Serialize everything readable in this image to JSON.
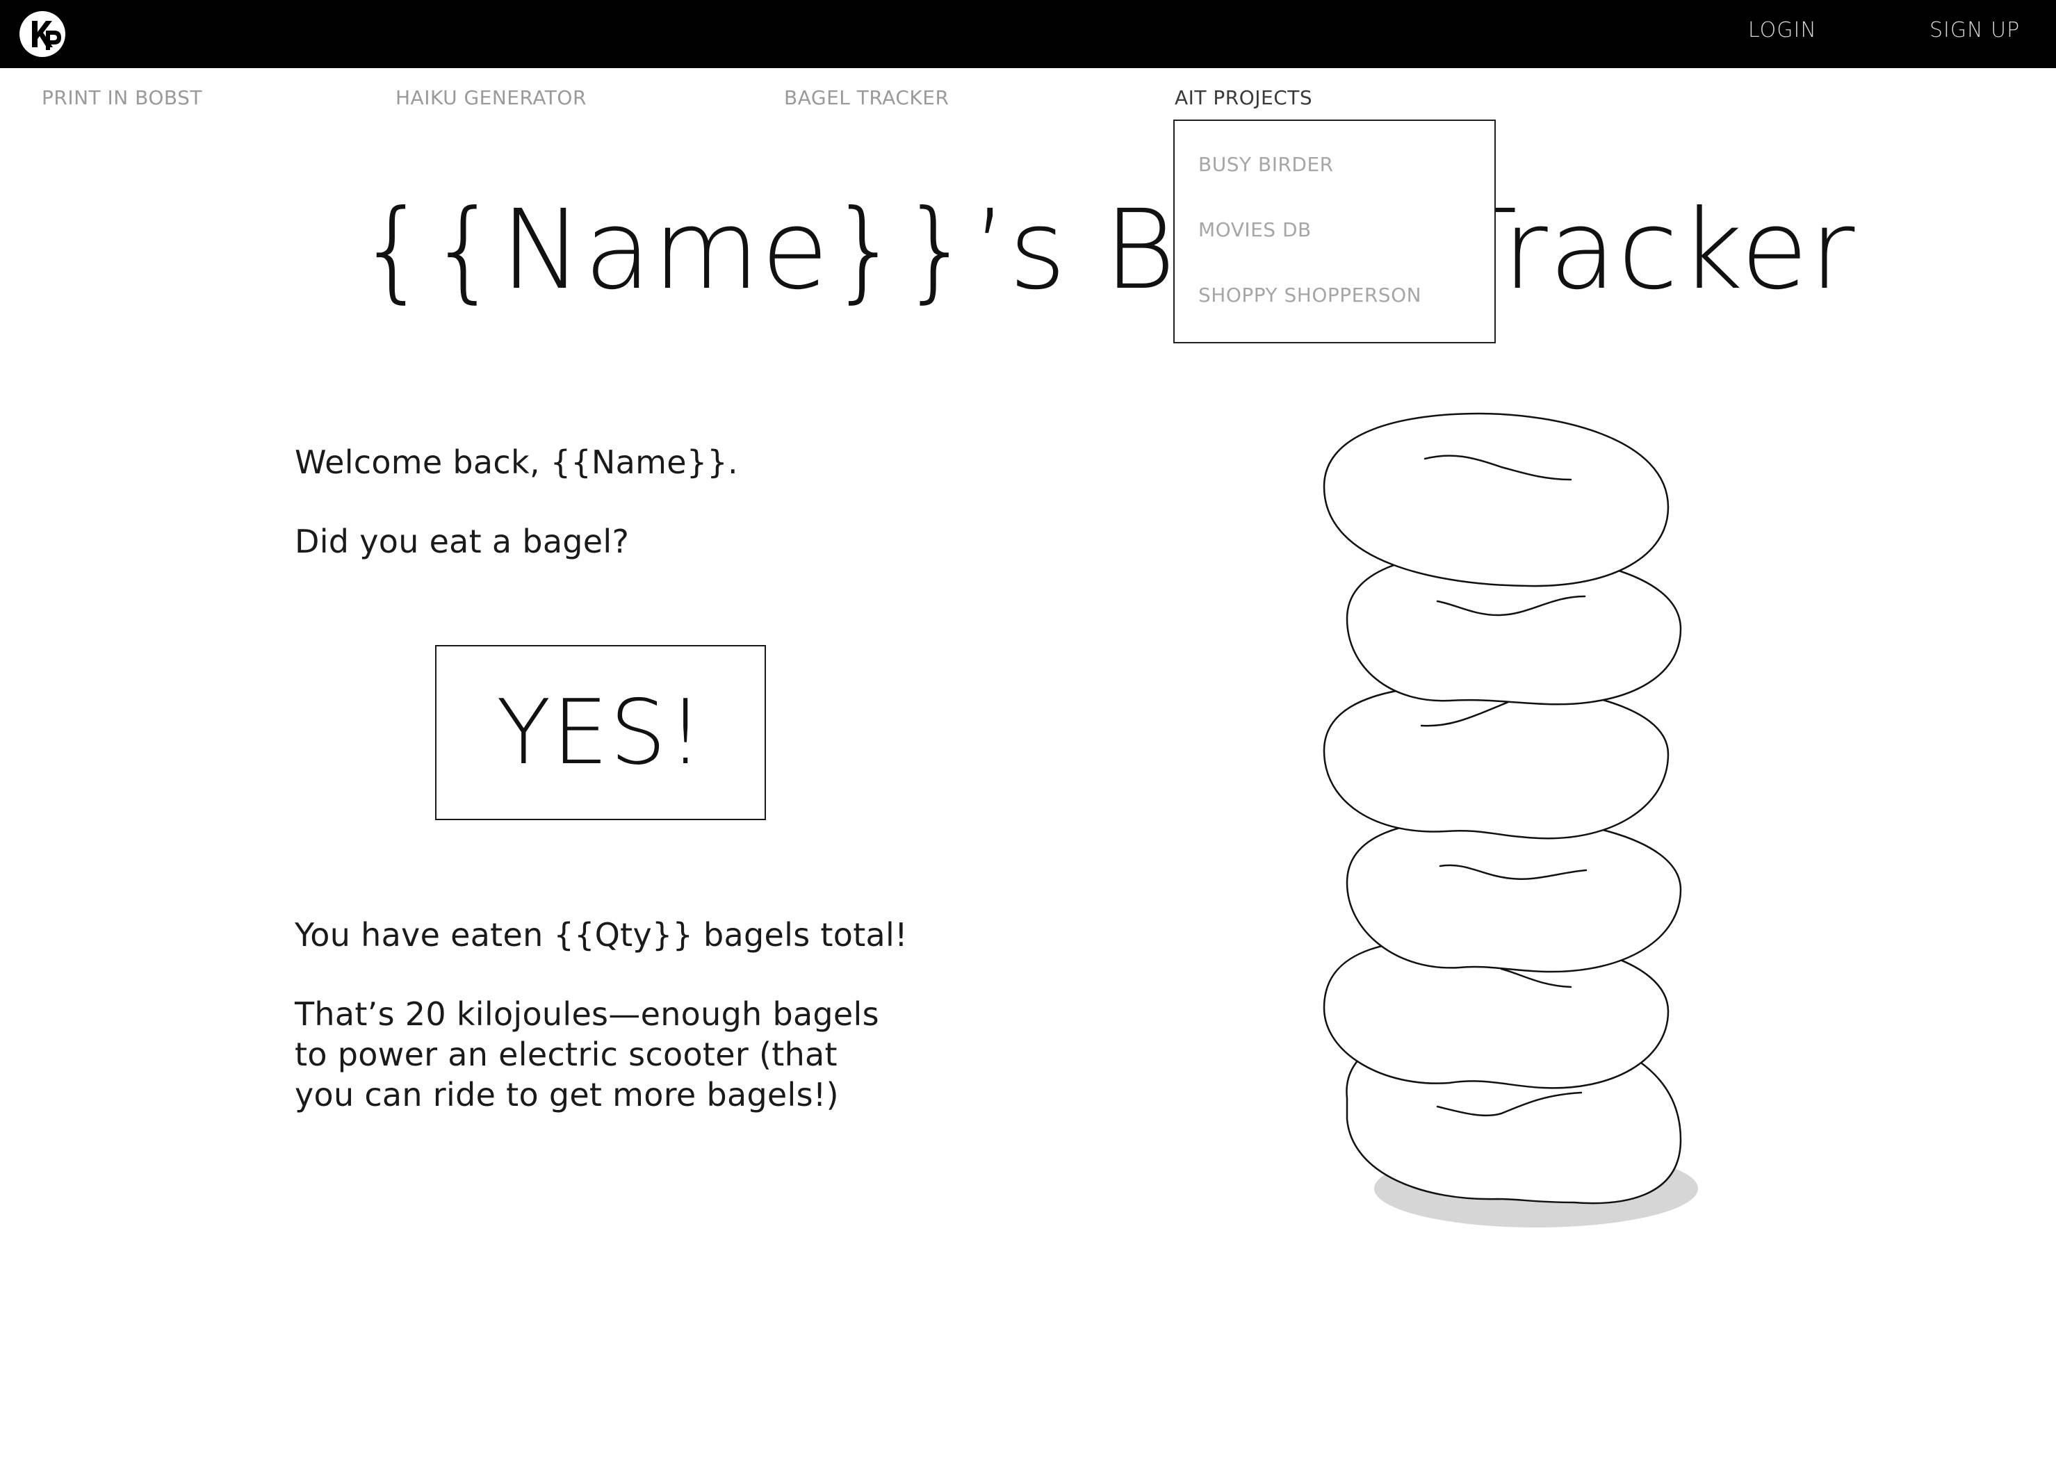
{
  "header": {
    "logo_text": "KP",
    "login_label": "LOGIN",
    "signup_label": "SIGN UP"
  },
  "nav": {
    "items": [
      {
        "label": "PRINT IN BOBST"
      },
      {
        "label": "HAIKU GENERATOR"
      },
      {
        "label": "BAGEL TRACKER"
      },
      {
        "label": "AIT PROJECTS"
      }
    ],
    "dropdown": {
      "items": [
        {
          "label": "BUSY BIRDER"
        },
        {
          "label": "MOVIES DB"
        },
        {
          "label": "SHOPPY SHOPPERSON"
        }
      ]
    }
  },
  "main": {
    "title": "{{Name}}’s Bagel Tracker",
    "welcome": "Welcome back, {{Name}}.",
    "question": "Did you eat a bagel?",
    "yes_button_label": "YES!",
    "total_text": "You have eaten {{Qty}} bagels total!",
    "fact_text": "That’s 20 kilojoules—enough bagels to power an electric scooter (that you can ride to get more bagels!)"
  },
  "colors": {
    "topbar": "#000000",
    "nav_inactive": "#9a9a9a",
    "nav_active": "#3a3a3a",
    "dropdown_item": "#a6a6a6",
    "shadow": "#d6d6d6"
  }
}
